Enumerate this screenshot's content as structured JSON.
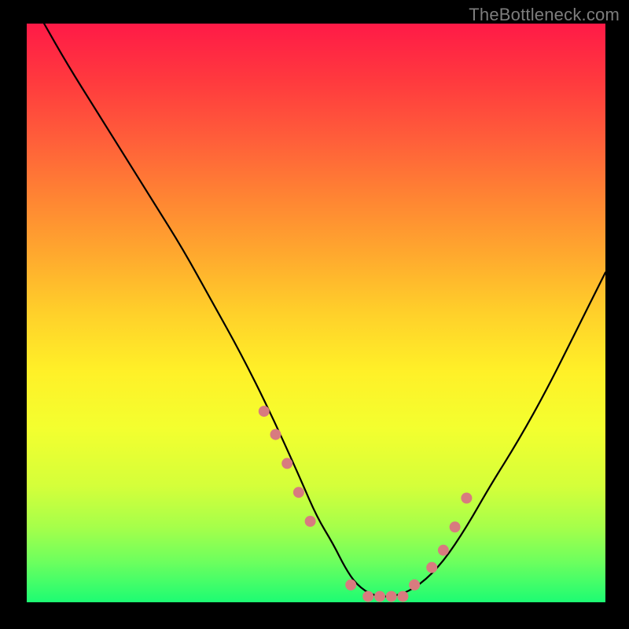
{
  "watermark": "TheBottleneck.com",
  "chart_data": {
    "type": "line",
    "title": "",
    "xlabel": "",
    "ylabel": "",
    "xlim": [
      0,
      100
    ],
    "ylim": [
      0,
      100
    ],
    "series": [
      {
        "name": "bottleneck-curve",
        "x": [
          3,
          7,
          12,
          17,
          22,
          27,
          32,
          37,
          42,
          47,
          50,
          53,
          55,
          57,
          60,
          64,
          68,
          72,
          76,
          80,
          85,
          90,
          95,
          100
        ],
        "y": [
          100,
          93,
          85,
          77,
          69,
          61,
          52,
          43,
          33,
          22,
          15,
          10,
          6,
          3,
          1,
          1,
          3,
          7,
          13,
          20,
          28,
          37,
          47,
          57
        ]
      }
    ],
    "markers": {
      "name": "highlight-dots",
      "color": "#d87b7f",
      "x": [
        41,
        43,
        45,
        47,
        49,
        56,
        59,
        61,
        63,
        65,
        67,
        70,
        72,
        74,
        76
      ],
      "y": [
        33,
        29,
        24,
        19,
        14,
        3,
        1,
        1,
        1,
        1,
        3,
        6,
        9,
        13,
        18
      ]
    }
  }
}
